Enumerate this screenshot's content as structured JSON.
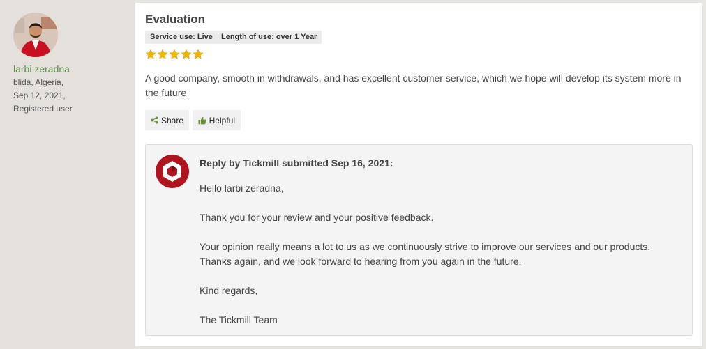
{
  "user": {
    "name": "larbi zeradna",
    "location": "blida, Algeria,",
    "date": "Sep 12, 2021,",
    "status": "Registered user"
  },
  "review": {
    "title": "Evaluation",
    "tags": [
      "Service use: Live",
      "Length of use: over 1 Year"
    ],
    "rating": 5,
    "rating_max": 5,
    "star_color": "#f5b800",
    "text": "A good company, smooth in withdrawals, and has excellent customer service, which we hope will develop its system more in the future",
    "actions": {
      "share_label": "Share",
      "helpful_label": "Helpful"
    }
  },
  "reply": {
    "header": "Reply by Tickmill submitted Sep 16, 2021:",
    "greeting": "Hello larbi zeradna,",
    "paragraph1": "Thank you for your review and your positive feedback.",
    "paragraph2_line1": "Your opinion really means a lot to us as we continuously strive to improve our services and our products.",
    "paragraph2_line2": "Thanks again, and we look forward to hearing from you again in the future.",
    "closing": "Kind regards,",
    "signature": "The Tickmill Team",
    "brand_color": "#b0141e"
  },
  "icons": {
    "share": "share-icon",
    "helpful": "thumbs-up-icon",
    "star": "star-icon",
    "logo": "tickmill-logo-icon"
  },
  "colors": {
    "username": "#5e8e4a",
    "sidebar_bg": "#e4e1dc",
    "reply_bg": "#f4f4f4"
  }
}
